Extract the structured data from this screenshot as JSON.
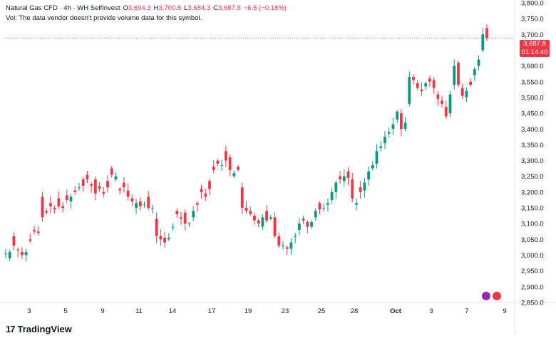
{
  "header": {
    "symbol": "Natural Gas CFD · 4h · WH SelfInvest",
    "o_label": "O",
    "o_value": "3,694.3",
    "h_label": "H",
    "h_value": "3,700.8",
    "l_label": "L",
    "l_value": "3,684.3",
    "c_label": "C",
    "c_value": "3,687.8",
    "change": "−6.5 (−0.18%)",
    "volume_note": "Vol: The data vendor doesn't provide volume data for this symbol."
  },
  "price_tag": {
    "price": "3,687.8",
    "countdown": "01:14:40"
  },
  "logo": {
    "text": "TradingView",
    "mark": "17"
  },
  "colors": {
    "up": "#089981",
    "down": "#f23645",
    "axis_text": "#131722",
    "price_line": "#f23645"
  },
  "chart_data": {
    "type": "candlestick",
    "y_range": [
      2850,
      3800
    ],
    "y_ticks": [
      "2,850.0",
      "2,900.0",
      "2,950.0",
      "3,000.0",
      "3,050.0",
      "3,100.0",
      "3,150.0",
      "3,200.0",
      "3,250.0",
      "3,300.0",
      "3,350.0",
      "3,400.0",
      "3,450.0",
      "3,500.0",
      "3,550.0",
      "3,600.0",
      "3,650.0",
      "3,700.0",
      "3,750.0",
      "3,800.0"
    ],
    "x_labels": [
      "3",
      "5",
      "9",
      "11",
      "14",
      "17",
      "19",
      "23",
      "25",
      "28",
      "Oct",
      "3",
      "7",
      "9"
    ],
    "last_price": 3687.8,
    "anchors": [
      [
        3005,
        2990,
        3060,
        3018,
        3010,
        3000,
        3050,
        3080,
        3075,
        3185,
        3140,
        3165,
        3150,
        3180,
        3155,
        3190,
        3170,
        3205,
        3215,
        3240,
        3255,
        3225,
        3240,
        3218,
        3200,
        3235,
        3275,
        3240,
        3210,
        3230,
        3205,
        3180,
        3150,
        3170,
        3160,
        3185,
        3150,
        3115,
        3060,
        3055,
        3050,
        3090,
        3140,
        3120,
        3135,
        3100,
        3120,
        3165,
        3210,
        3195,
        3235,
        3280,
        3300,
        3285,
        3330,
        3310,
        3250,
        3280,
        3215,
        3150,
        3140,
        3125,
        3110,
        3090,
        3140,
        3115,
        3120,
        3060,
        3030,
        3025,
        3020,
        3060,
        3080,
        3115,
        3105,
        3090,
        3120,
        3165,
        3150,
        3160,
        3175,
        3200,
        3250,
        3235,
        3265,
        3240,
        3160,
        3215,
        3205,
        3240,
        3275,
        3290,
        3340,
        3355,
        3385,
        3400,
        3430,
        3450,
        3400,
        3480,
        3565,
        3545,
        3525,
        3535,
        3560,
        3555,
        3510,
        3490,
        3470,
        3450,
        3540,
        3610,
        3530,
        3500,
        3550,
        3570,
        3600,
        3650,
        3720,
        3688
      ],
      [
        3005,
        3010,
        3030,
        3015,
        3000,
        3010,
        3045,
        3075,
        3070,
        3120,
        3135,
        3155,
        3145,
        3155,
        3150,
        3175,
        3185,
        3200,
        3215,
        3220,
        3240,
        3220,
        3195,
        3210,
        3195,
        3215,
        3255,
        3250,
        3205,
        3215,
        3185,
        3170,
        3165,
        3155,
        3160,
        3150,
        3150,
        3060,
        3050,
        3040,
        3055,
        3090,
        3130,
        3115,
        3100,
        3100,
        3140,
        3160,
        3200,
        3185,
        3210,
        3270,
        3290,
        3285,
        3300,
        3270,
        3260,
        3270,
        3150,
        3140,
        3130,
        3110,
        3100,
        3120,
        3110,
        3120,
        3060,
        3030,
        3030,
        3020,
        3040,
        3060,
        3100,
        3110,
        3090,
        3105,
        3140,
        3145,
        3150,
        3165,
        3200,
        3230,
        3240,
        3250,
        3245,
        3180,
        3165,
        3200,
        3230,
        3265,
        3285,
        3330,
        3345,
        3375,
        3390,
        3415,
        3455,
        3400,
        3420,
        3565,
        3555,
        3530,
        3520,
        3545,
        3550,
        3530,
        3495,
        3480,
        3440,
        3510,
        3600,
        3540,
        3505,
        3520,
        3540,
        3590,
        3620,
        3700,
        3688
      ]
    ]
  }
}
